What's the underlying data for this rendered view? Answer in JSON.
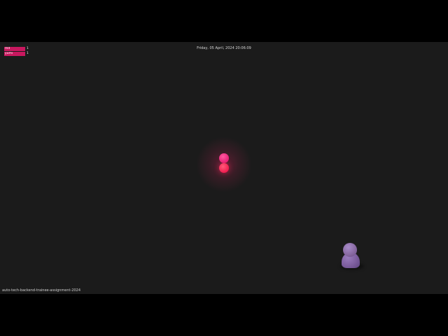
{
  "header": {
    "datetime": "Friday, 05 April, 2024 20:06:09"
  },
  "legend": {
    "items": [
      {
        "name": "md",
        "count": "1",
        "color": "#c8185f"
      },
      {
        "name": "yumi",
        "count": "1",
        "color": "#c8185f"
      }
    ]
  },
  "footer": {
    "text": "auto-tech-backend-trainee-assignment-2024"
  },
  "players": {
    "local": {
      "color": "#e52178",
      "glow": "#ff2a6e"
    },
    "remote": {
      "color": "#8a6aab"
    }
  }
}
